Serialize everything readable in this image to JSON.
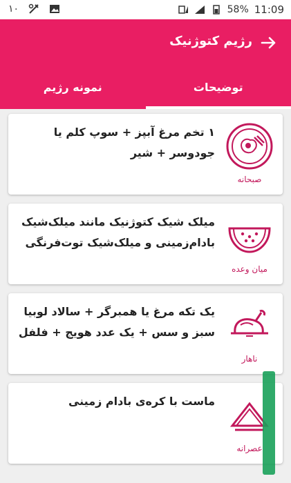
{
  "status": {
    "time": "11:09",
    "battery": "58%",
    "notif": "۱۰"
  },
  "appbar": {
    "title": "رژیم کتوژنیک",
    "tabs": [
      {
        "label": "توضیحات",
        "active": true
      },
      {
        "label": "نمونه رژیم",
        "active": false
      }
    ]
  },
  "colors": {
    "primary": "#e91e63",
    "accent": "#c2185b"
  },
  "meals": [
    {
      "name": "صبحانه",
      "icon": "breakfast-egg-icon",
      "text": "۱ تخم مرغ آبپز + سوپ کلم یا جودوسر + شیر"
    },
    {
      "name": "میان وعده",
      "icon": "watermelon-icon",
      "text": "میلک شیک کتوژنیک مانند میلک‌شیک بادام‌زمینی و میلک‌شیک توت‌فرنگی"
    },
    {
      "name": "ناهار",
      "icon": "roast-chicken-icon",
      "text": "یک تکه مرغ یا همبرگر + سالاد لوبیا سبز و سس + یک عدد هویج + فلفل"
    },
    {
      "name": "عصرانه",
      "icon": "sandwich-icon",
      "text": "ماست با کره‌ی بادام زمینی"
    }
  ]
}
